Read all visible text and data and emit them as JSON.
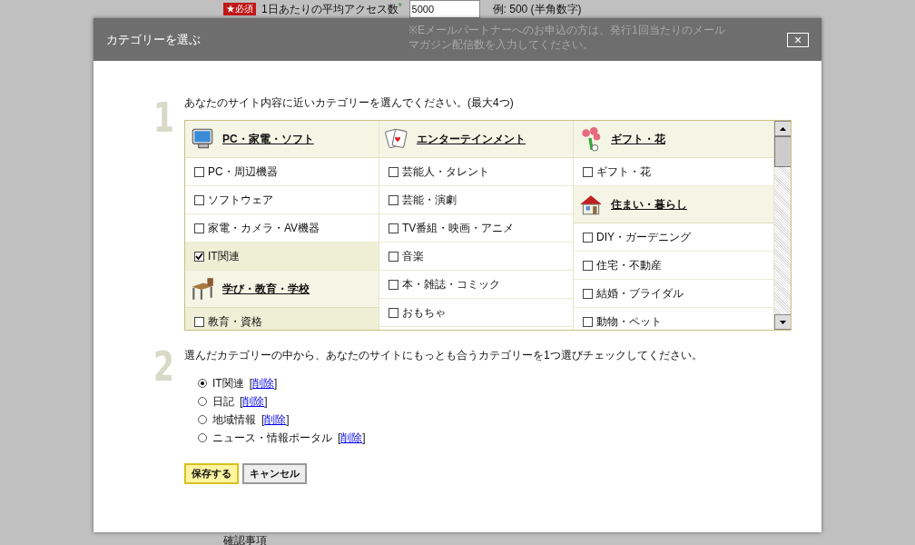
{
  "background_page": {
    "required_badge": "★必須",
    "field_label": "1日あたりの平均アクセス数",
    "required_mark": "*",
    "field_value": "5000",
    "example": "例: 500 (半角数字)",
    "note": "※Eメールパートナーへのお申込の方は、発行1回当たりのメールマガジン配信数を入力してください。",
    "footer_heading": "確認事項"
  },
  "dialog": {
    "title": "カテゴリーを選ぶ",
    "close_label": "×",
    "step1": {
      "number": "1",
      "instruction": "あなたのサイト内容に近いカテゴリーを選んでください。(最大4つ)",
      "columns": [
        {
          "groups": [
            {
              "title": "PC・家電・ソフト",
              "items": [
                {
                  "label": "PC・周辺機器",
                  "checked": false,
                  "highlighted": false
                },
                {
                  "label": "ソフトウェア",
                  "checked": false,
                  "highlighted": false
                },
                {
                  "label": "家電・カメラ・AV機器",
                  "checked": false,
                  "highlighted": false
                },
                {
                  "label": "IT関連",
                  "checked": true,
                  "highlighted": true
                }
              ]
            },
            {
              "title": "学び・教育・学校",
              "items": [
                {
                  "label": "教育・資格",
                  "checked": false,
                  "highlighted": true
                }
              ]
            }
          ]
        },
        {
          "groups": [
            {
              "title": "エンターテインメント",
              "items": [
                {
                  "label": "芸能人・タレント",
                  "checked": false,
                  "highlighted": false
                },
                {
                  "label": "芸能・演劇",
                  "checked": false,
                  "highlighted": false
                },
                {
                  "label": "TV番組・映画・アニメ",
                  "checked": false,
                  "highlighted": false
                },
                {
                  "label": "音楽",
                  "checked": false,
                  "highlighted": false
                },
                {
                  "label": "本・雑誌・コミック",
                  "checked": false,
                  "highlighted": false
                },
                {
                  "label": "おもちゃ",
                  "checked": false,
                  "highlighted": false
                }
              ]
            }
          ]
        },
        {
          "groups": [
            {
              "title": "ギフト・花",
              "items": [
                {
                  "label": "ギフト・花",
                  "checked": false,
                  "highlighted": false
                }
              ]
            },
            {
              "title": "住まい・暮らし",
              "items": [
                {
                  "label": "DIY・ガーデニング",
                  "checked": false,
                  "highlighted": false
                },
                {
                  "label": "住宅・不動産",
                  "checked": false,
                  "highlighted": false
                },
                {
                  "label": "結婚・ブライダル",
                  "checked": false,
                  "highlighted": false
                },
                {
                  "label": "動物・ペット",
                  "checked": false,
                  "highlighted": false
                }
              ]
            }
          ]
        }
      ]
    },
    "step2": {
      "number": "2",
      "instruction": "選んだカテゴリーの中から、あなたのサイトにもっとも合うカテゴリーを1つ選びチェックしてください。",
      "choices": [
        {
          "label": "IT関連",
          "selected": true,
          "bracket_open": "[",
          "delete_link": "削除",
          "bracket_close": "]"
        },
        {
          "label": "日記",
          "selected": false,
          "bracket_open": "[",
          "delete_link": "削除",
          "bracket_close": "]"
        },
        {
          "label": "地域情報",
          "selected": false,
          "bracket_open": "[",
          "delete_link": "削除",
          "bracket_close": "]"
        },
        {
          "label": "ニュース・情報ポータル",
          "selected": false,
          "bracket_open": "[",
          "delete_link": "削除",
          "bracket_close": "]"
        }
      ]
    },
    "buttons": [
      {
        "label": "保存する",
        "kind": "primary"
      },
      {
        "label": "キャンセル",
        "kind": "secondary"
      }
    ]
  }
}
